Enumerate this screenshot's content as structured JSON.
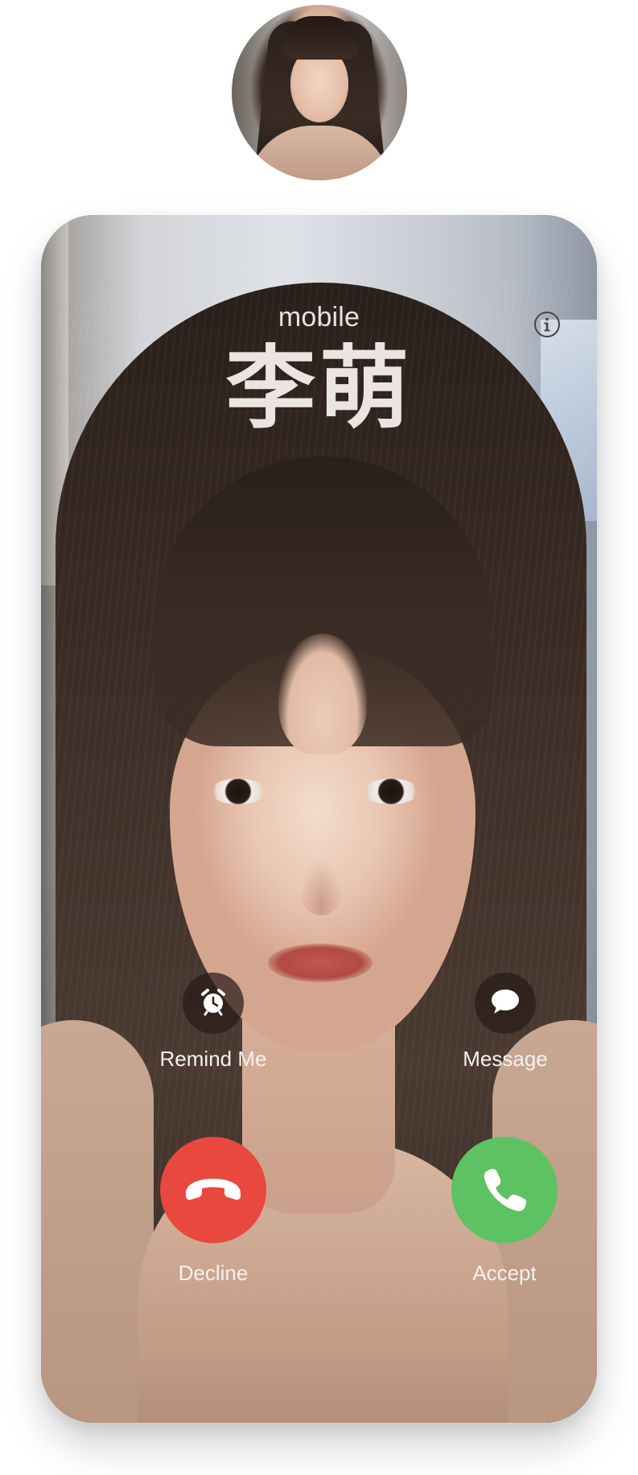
{
  "call": {
    "type_label": "mobile",
    "caller_name": "李萌"
  },
  "actions": {
    "remind_label": "Remind Me",
    "message_label": "Message",
    "decline_label": "Decline",
    "accept_label": "Accept"
  },
  "icons": {
    "info": "info-icon",
    "remind": "alarm-clock-icon",
    "message": "speech-bubble-icon",
    "decline": "phone-hangup-icon",
    "accept": "phone-icon"
  },
  "colors": {
    "decline": "#E9483E",
    "accept": "#5DC262",
    "secondary_button": "#2E201B",
    "text": "#F5F2EF"
  }
}
